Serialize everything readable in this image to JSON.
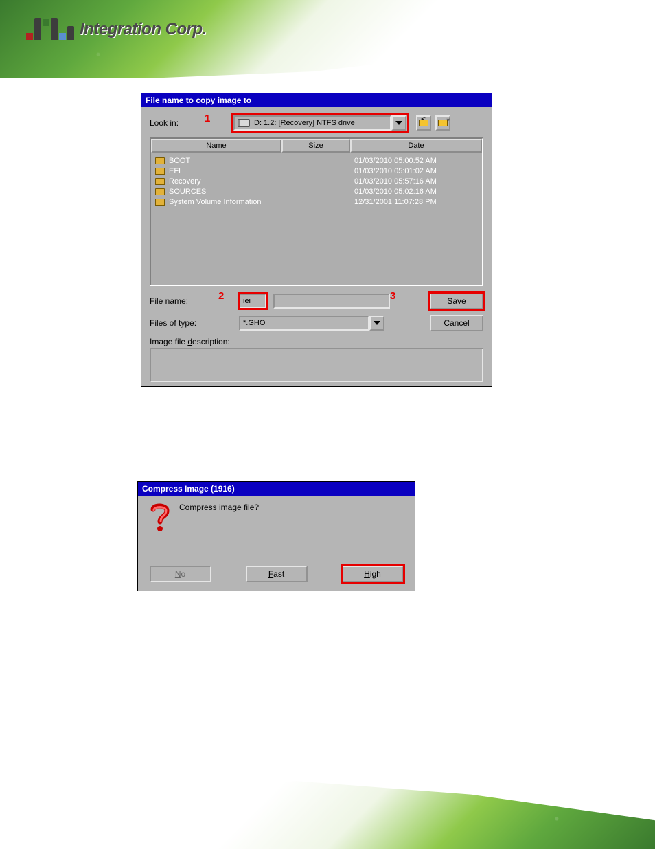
{
  "logo_text": "Integration Corp.",
  "dlg1": {
    "title": "File name to copy image to",
    "look_in_label": "Look in:",
    "look_in_value": "D: 1.2: [Recovery] NTFS drive",
    "annot1": "1",
    "annot2": "2",
    "annot3": "3",
    "cols": {
      "name": "Name",
      "size": "Size",
      "date": "Date"
    },
    "rows": [
      {
        "name": "BOOT",
        "size": "",
        "date": "01/03/2010 05:00:52 AM"
      },
      {
        "name": "EFI",
        "size": "",
        "date": "01/03/2010 05:01:02 AM"
      },
      {
        "name": "Recovery",
        "size": "",
        "date": "01/03/2010 05:57:16 AM"
      },
      {
        "name": "SOURCES",
        "size": "",
        "date": "01/03/2010 05:02:16 AM"
      },
      {
        "name": "System Volume Information",
        "size": "",
        "date": "12/31/2001 11:07:28 PM"
      }
    ],
    "file_name_label": "File name:",
    "file_name_value": "iei",
    "files_type_label": "Files of type:",
    "files_type_value": "*.GHO",
    "desc_label": "Image file description:",
    "save": "Save",
    "cancel": "Cancel"
  },
  "dlg2": {
    "title": "Compress Image (1916)",
    "message": "Compress image file?",
    "no": "No",
    "fast": "Fast",
    "high": "High"
  }
}
